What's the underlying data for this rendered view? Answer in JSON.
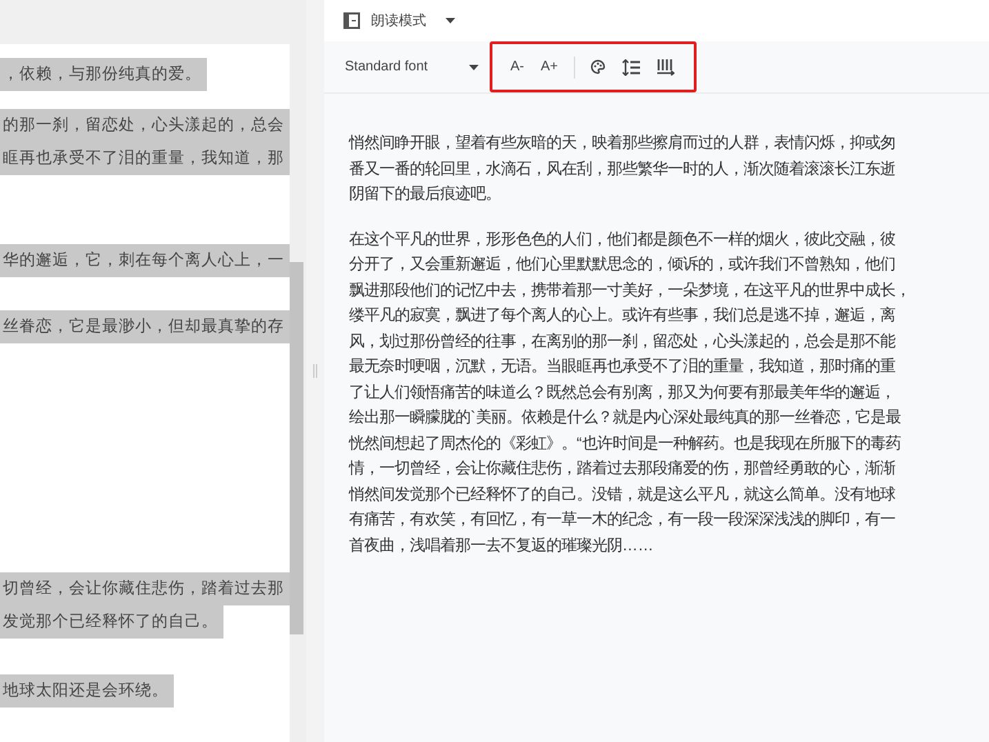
{
  "left_panel": {
    "lines": [
      "，依赖，与那份纯真的爱。",
      "的那一刹，留恋处，心头漾起的，总会",
      "眶再也承受不了泪的重量，我知道，那",
      "华的邂逅，它，刺在每个离人心上，一",
      "丝眷恋，它是最渺小，但却最真挚的存",
      "切曾经，会让你藏住悲伤，踏着过去那",
      "发觉那个已经释怀了的自己。",
      "地球太阳还是会环绕。"
    ]
  },
  "header": {
    "mode_label": "朗读模式"
  },
  "toolbar": {
    "font_select": "Standard font",
    "font_size_buttons": [
      "A-",
      "A+"
    ]
  },
  "reader": {
    "paragraphs": [
      [
        "悄然间睁开眼，望着有些灰暗的天，映着那些擦肩而过的人群，表情闪烁，抑或匆",
        "番又一番的轮回里，水滴石，风在刮，那些繁华一时的人，渐次随着滚滚长江东逝",
        "阴留下的最后痕迹吧。"
      ],
      [
        "在这个平凡的世界，形形色色的人们，他们都是颜色不一样的烟火，彼此交融，彼",
        "分开了，又会重新邂逅，他们心里默默思念的，倾诉的，或许我们不曾熟知，他们",
        "飘进那段他们的记忆中去，携带着那一寸美好，一朵梦境，在这平凡的世界中成长，",
        "缕平凡的寂寞，飘进了每个离人的心上。或许有些事，我们总是逃不掉，邂逅，离",
        "风，划过那份曾经的往事，在离别的那一刹，留恋处，心头漾起的，总会是那不能",
        "最无奈时哽咽，沉默，无语。当眼眶再也承受不了泪的重量，我知道，那时痛的重",
        "了让人们领悟痛苦的味道么？既然总会有别离，那又为何要有那最美年华的邂逅，",
        "绘出那一瞬朦胧的`美丽。依赖是什么？就是内心深处最纯真的那一丝眷恋，它是最",
        "恍然间想起了周杰伦的《彩虹》。“也许时间是一种解药。也是我现在所服下的毒药",
        "情，一切曾经，会让你藏住悲伤，踏着过去那段痛爱的伤，那曾经勇敢的心，渐渐",
        "悄然间发觉那个已经释怀了的自己。没错，就是这么平凡，就这么简单。没有地球",
        "有痛苦，有欢笑，有回忆，有一草一木的纪念，有一段一段深深浅浅的脚印，有一",
        "首夜曲，浅唱着那一去不复返的璀璨光阴……"
      ]
    ]
  }
}
